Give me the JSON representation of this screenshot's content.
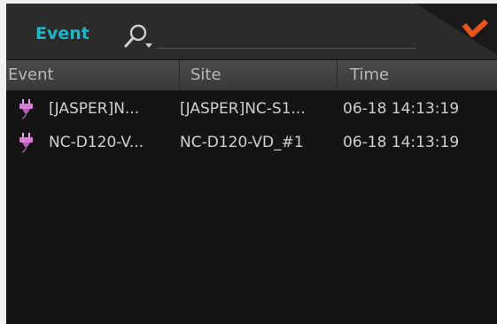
{
  "header": {
    "title": "Event",
    "search_value": ""
  },
  "table": {
    "columns": [
      "Event",
      "Site",
      "Time"
    ],
    "rows": [
      {
        "event": "[JASPER]N...",
        "site": "[JASPER]NC-S1...",
        "time": "06-18 14:13:19",
        "icon": "plug-icon"
      },
      {
        "event": "NC-D120-V...",
        "site": "NC-D120-VD_#1",
        "time": "06-18 14:13:19",
        "icon": "plug-icon"
      }
    ]
  },
  "colors": {
    "accent": "#1fb4c8",
    "check": "#e8541a",
    "background": "#141414",
    "header": "#2b2b2b"
  }
}
